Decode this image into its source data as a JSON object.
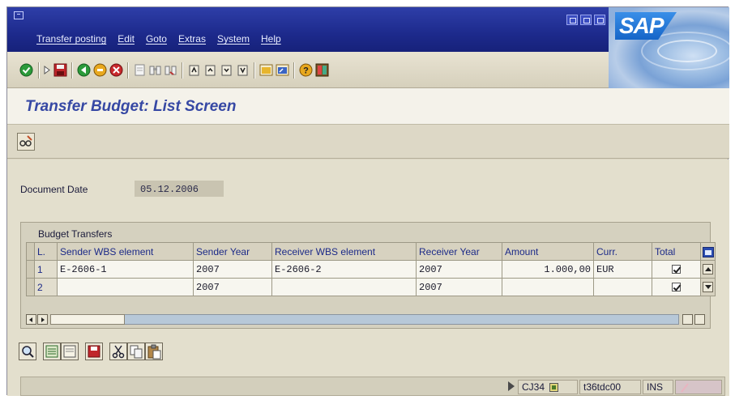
{
  "menu": [
    "Transfer posting",
    "Edit",
    "Goto",
    "Extras",
    "System",
    "Help"
  ],
  "brand": "SAP",
  "toolbar_icons": [
    "enter-icon",
    "save-icon",
    "back-icon",
    "exit-icon",
    "cancel-icon",
    "print-icon",
    "find-icon",
    "find-next-icon",
    "first-page-icon",
    "previous-page-icon",
    "next-page-icon",
    "last-page-icon",
    "create-session-icon",
    "shortcut-icon",
    "help-icon",
    "layout-icon"
  ],
  "page_title": "Transfer Budget: List Screen",
  "document_date": {
    "label": "Document Date",
    "value": "05.12.2006"
  },
  "budget_transfers": {
    "title": "Budget Transfers",
    "columns": [
      "L.",
      "Sender WBS element",
      "Sender Year",
      "Receiver WBS element",
      "Receiver Year",
      "Amount",
      "Curr.",
      "Total"
    ],
    "rows": [
      {
        "line": "1",
        "sender_wbs": "E-2606-1",
        "sender_year": "2007",
        "receiver_wbs": "E-2606-2",
        "receiver_year": "2007",
        "amount": "1.000,00",
        "currency": "EUR",
        "total": true
      },
      {
        "line": "2",
        "sender_wbs": "",
        "sender_year": "2007",
        "receiver_wbs": "",
        "receiver_year": "2007",
        "amount": "",
        "currency": "",
        "total": true
      }
    ]
  },
  "status": {
    "transaction": "CJ34",
    "server": "t36tdc00",
    "mode": "INS"
  }
}
